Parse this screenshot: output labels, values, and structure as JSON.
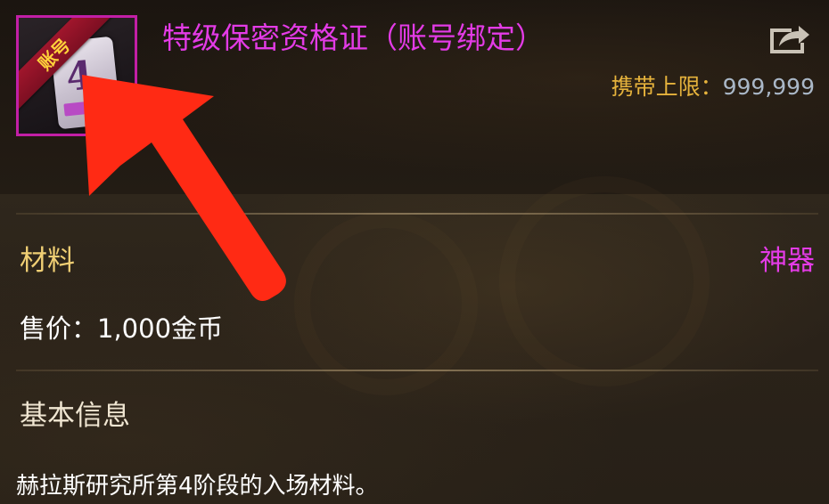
{
  "item": {
    "name": "特级保密资格证（账号绑定）",
    "badge": "账号",
    "card_number": "4",
    "carry_limit_label": "携带上限：",
    "carry_limit_value": "999,999",
    "category": "材料",
    "rarity": "神器",
    "price": "售价：1,000金币",
    "section_basic_info": "基本信息",
    "description": "赫拉斯研究所第4阶段的入场材料。"
  },
  "icons": {
    "share": "share-export-icon",
    "annotation": "red-arrow-annotation"
  },
  "colors": {
    "item_name": "#e33be6",
    "rarity": "#e33be6",
    "category": "#f0cf74",
    "carry_label": "#e5b23c",
    "carry_value": "#aab8c8",
    "frame_border": "#c21fa6",
    "annotation_arrow": "#ff2a14"
  }
}
